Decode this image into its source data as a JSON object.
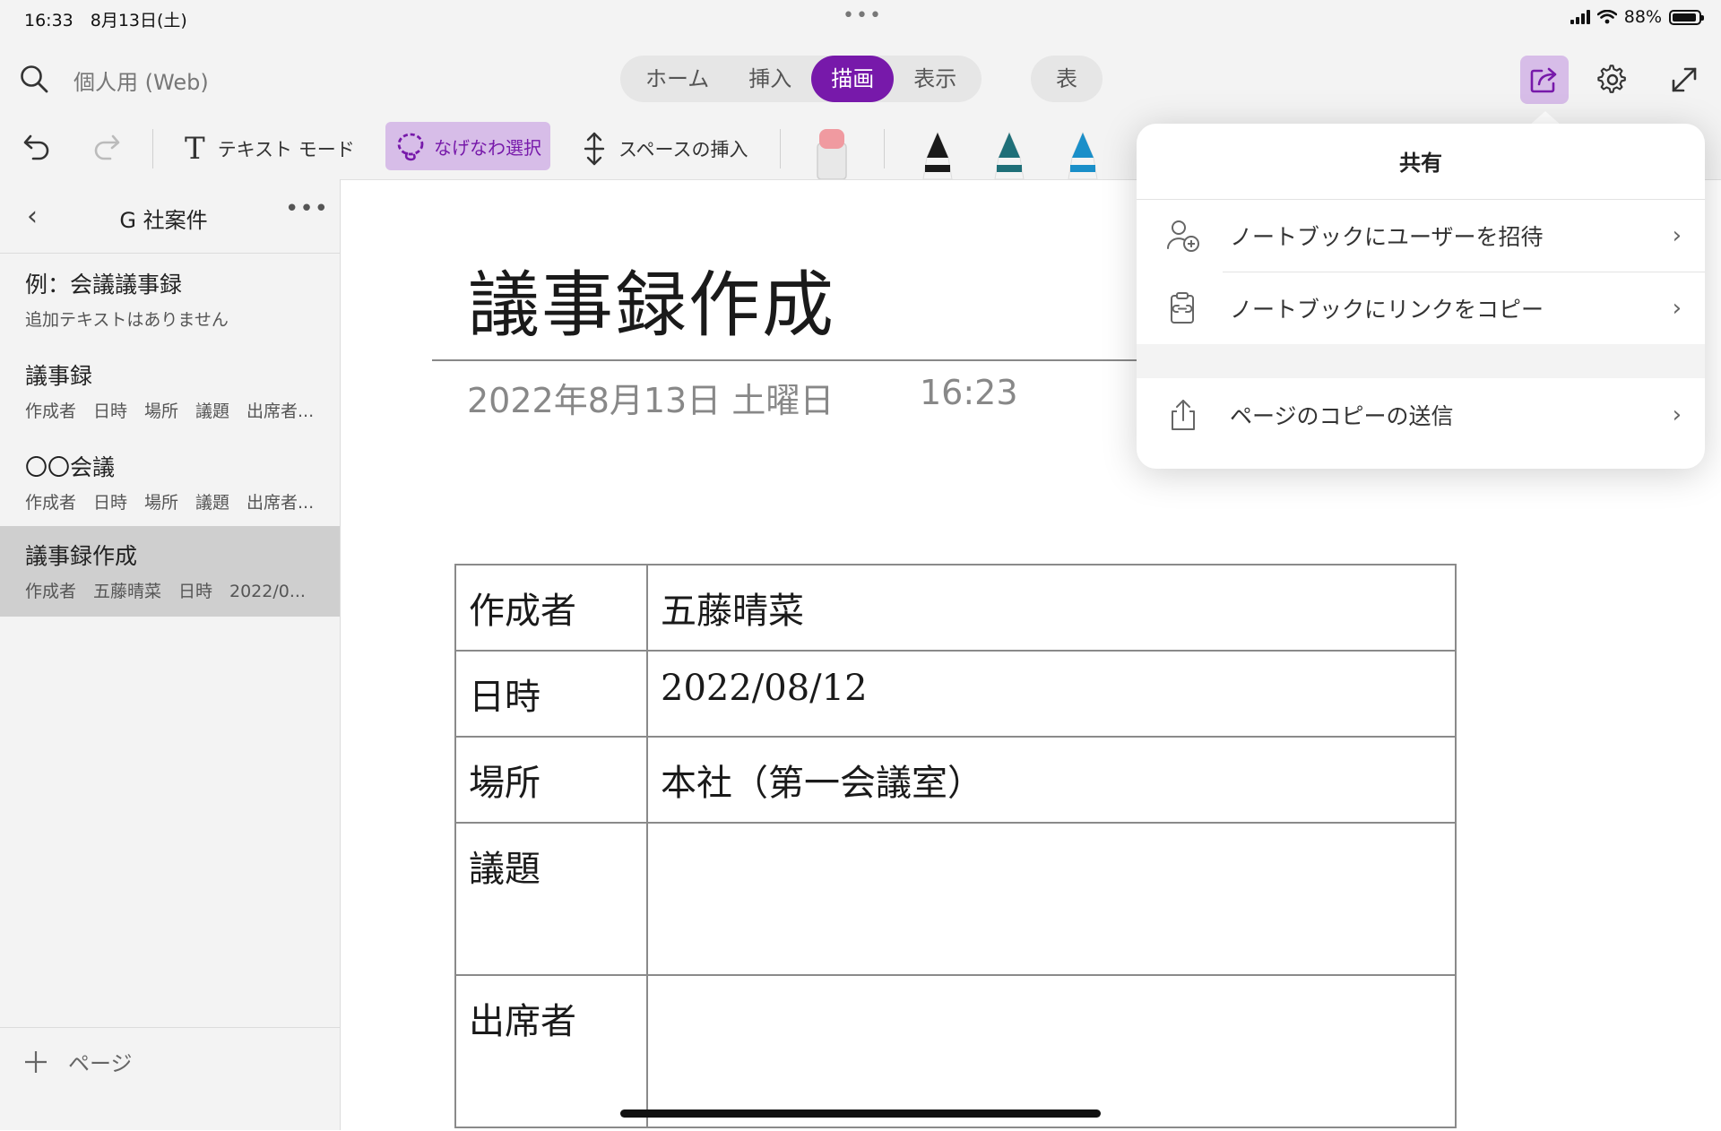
{
  "status_bar": {
    "time_date": "16:33　8月13日(土)",
    "dots": "•••",
    "battery": "88%"
  },
  "header": {
    "notebook": "個人用 (Web)",
    "tabs": [
      {
        "label": "ホーム"
      },
      {
        "label": "挿入"
      },
      {
        "label": "描画"
      },
      {
        "label": "表示"
      }
    ],
    "active_tab": "描画",
    "extra_tab": "表"
  },
  "toolbar": {
    "text_mode": "テキスト モード",
    "lasso_select": "なげなわ選択",
    "insert_space": "スペースの挿入",
    "pen_colors": [
      "#1a1a1a",
      "#1f6f78",
      "#1a8fc9"
    ],
    "eraser_color": "#f09aa0"
  },
  "sidebar": {
    "section_title": "G 社案件",
    "pages": [
      {
        "title": "例：会議議事録",
        "subtitle": "追加テキストはありません"
      },
      {
        "title": "議事録",
        "subtitle": "作成者　日時　場所　議題　出席者..."
      },
      {
        "title": "〇〇会議",
        "subtitle": "作成者　日時　場所　議題　出席者..."
      },
      {
        "title": "議事録作成",
        "subtitle": "作成者　五藤晴菜　日時　2022/0..."
      }
    ],
    "selected_page": "議事録作成",
    "add_page": "ページ"
  },
  "page": {
    "title": "議事録作成",
    "date": "2022年8月13日 土曜日",
    "time": "16:23",
    "table": [
      {
        "key": "作成者",
        "value": "五藤晴菜"
      },
      {
        "key": "日時",
        "value": "2022/08/12"
      },
      {
        "key": "場所",
        "value": "本社（第一会議室）"
      },
      {
        "key": "議題",
        "value": ""
      },
      {
        "key": "出席者",
        "value": ""
      }
    ]
  },
  "share_popover": {
    "title": "共有",
    "items": [
      {
        "label": "ノートブックにユーザーを招待",
        "icon": "add-person-icon"
      },
      {
        "label": "ノートブックにリンクをコピー",
        "icon": "clipboard-link-icon"
      },
      {
        "label": "ページのコピーの送信",
        "icon": "upload-share-icon"
      }
    ]
  },
  "colors": {
    "accent": "#7719aa",
    "accent_light": "#d7bde8",
    "chrome_bg": "#f3f3f3"
  }
}
